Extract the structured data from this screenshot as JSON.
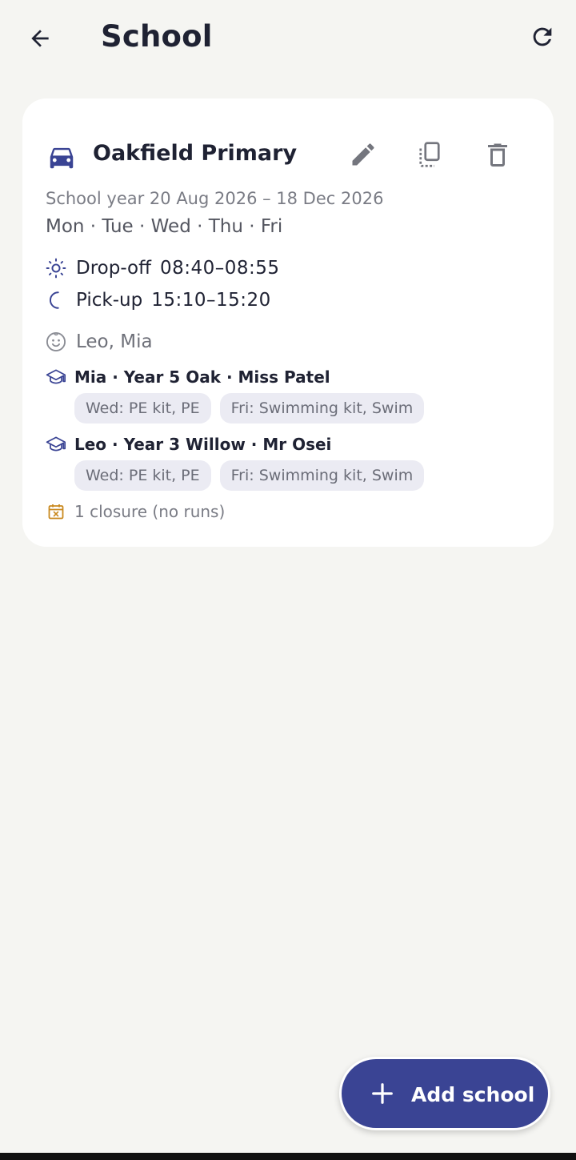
{
  "header": {
    "title": "School",
    "back_icon": "arrow-left-icon",
    "refresh_icon": "refresh-icon"
  },
  "school_card": {
    "name": "Oakfield Primary",
    "transport_icon": "car-icon",
    "accent_color": "#3a4494",
    "school_year": "School year 20 Aug 2026 – 18 Dec 2026",
    "weekdays": "Mon · Tue · Wed · Thu · Fri",
    "dropoff": {
      "label": "Drop-off",
      "value": "08:40–08:55",
      "icon": "sun-icon"
    },
    "pickup": {
      "label": "Pick-up",
      "value": "15:10–15:20",
      "icon": "moon-icon"
    },
    "children": {
      "text": "Leo, Mia",
      "icon": "child-face-icon"
    },
    "classes": [
      {
        "text": "Mia · Year 5 Oak · Miss Patel",
        "icon": "graduation-cap-icon",
        "chips": [
          "Wed: PE kit, PE",
          "Fri: Swimming kit, Swim"
        ]
      },
      {
        "text": "Leo · Year 3 Willow · Mr Osei",
        "icon": "graduation-cap-icon",
        "chips": [
          "Wed: PE kit, PE",
          "Fri: Swimming kit, Swim"
        ]
      }
    ],
    "closure": {
      "text": "1 closure (no runs)",
      "icon": "calendar-x-icon",
      "color": "#c9891f"
    },
    "actions": {
      "edit_icon": "pencil-icon",
      "copy_icon": "copy-icon",
      "delete_icon": "trash-icon"
    }
  },
  "fab": {
    "label": "Add school",
    "icon": "plus-icon",
    "color": "#3a4494"
  }
}
